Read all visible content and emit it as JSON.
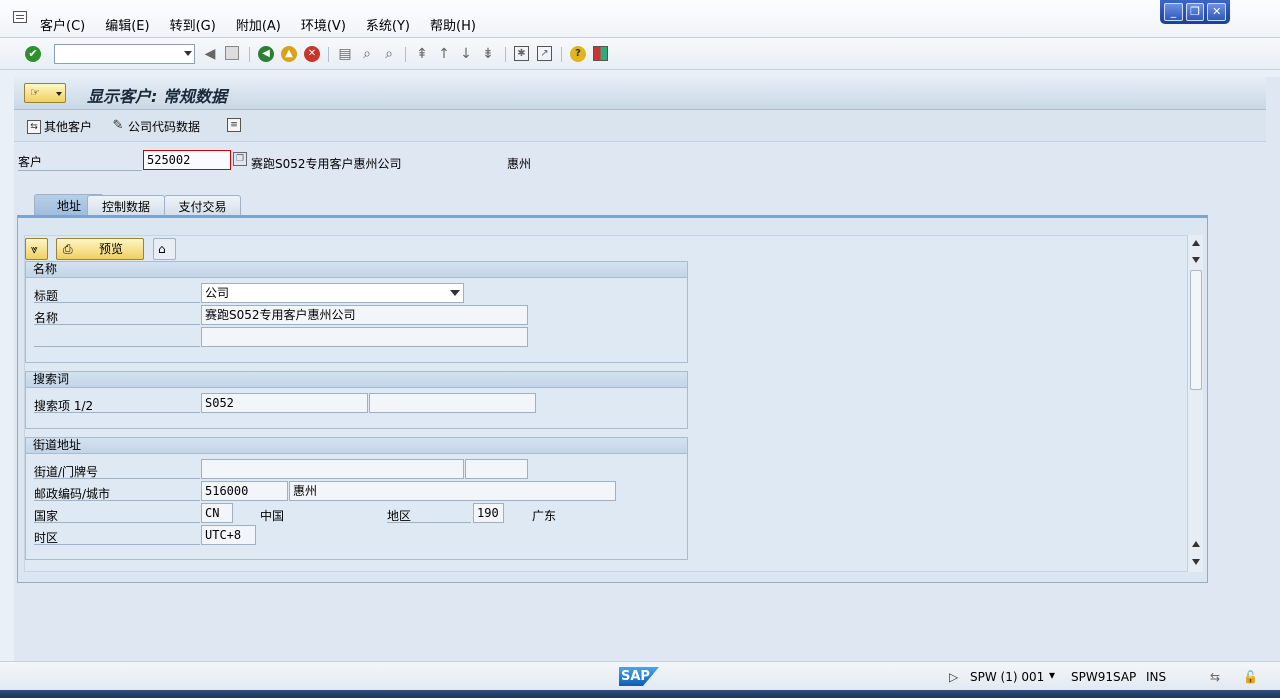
{
  "menu": {
    "items": [
      "客户(C)",
      "编辑(E)",
      "转到(G)",
      "附加(A)",
      "环境(V)",
      "系统(Y)",
      "帮助(H)"
    ]
  },
  "window_controls": {
    "minimize": "_",
    "restore": "❐",
    "close": "✕"
  },
  "page": {
    "title": "显示客户: 常规数据"
  },
  "app_toolbar": {
    "other_customer": "其他客户",
    "company_code_data": "公司代码数据"
  },
  "header": {
    "customer_label": "客户",
    "customer_number": "525002",
    "customer_name": "赛跑S052专用客户惠州公司",
    "city": "惠州"
  },
  "tabs": [
    {
      "label": "地址",
      "active": true
    },
    {
      "label": "控制数据",
      "active": false
    },
    {
      "label": "支付交易",
      "active": false
    }
  ],
  "address": {
    "preview_button": "预览",
    "name_group": {
      "title": "名称",
      "title_label": "标题",
      "title_value": "公司",
      "name_label": "名称",
      "name_value": "赛跑S052专用客户惠州公司",
      "name2_value": ""
    },
    "search_group": {
      "title": "搜索词",
      "search_label": "搜索项 1/2",
      "search1": "S052",
      "search2": ""
    },
    "street_group": {
      "title": "街道地址",
      "street_label": "街道/门牌号",
      "street_value": "",
      "house_no": "",
      "postal_label": "邮政编码/城市",
      "postal_code": "516000",
      "city": "惠州",
      "country_label": "国家",
      "country_code": "CN",
      "country_name": "中国",
      "region_label": "地区",
      "region_code": "190",
      "region_name": "广东",
      "timezone_label": "时区",
      "timezone": "UTC+8"
    }
  },
  "status_bar": {
    "system": "SPW (1) 001",
    "server": "SPW91SAP",
    "mode": "INS"
  },
  "colors": {
    "background": "#eaf0f7",
    "tab_active": "#9dbbdc",
    "button_yellow": "#eecf62",
    "required_border": "#cc0000"
  }
}
